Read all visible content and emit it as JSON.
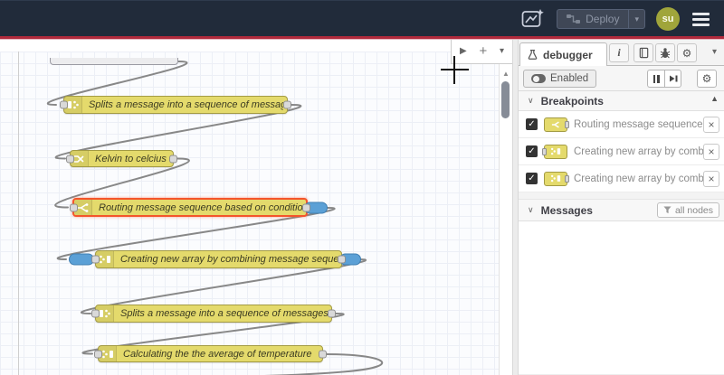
{
  "icons": {
    "chevron_down": "∨",
    "caret_down": "▾",
    "scroll_up_arrow": "▲",
    "scroll_right_arrow": "▶",
    "add": "+",
    "check": "✓",
    "gear": "⚙",
    "info": "i",
    "close": "×"
  },
  "header": {
    "deploy": {
      "label": "Deploy"
    },
    "avatar": {
      "initials": "su"
    }
  },
  "canvas": {
    "nodes": [
      {
        "type": "partial-node",
        "label": ""
      },
      {
        "label": "Splits a message into a sequence of messages.",
        "icon": "split-icon"
      },
      {
        "label": "Kelvin to celcius",
        "icon": "change-icon"
      },
      {
        "label": "Routing message sequence based on condition",
        "icon": "switch-icon",
        "selected": true,
        "breakpoints": [
          "output"
        ]
      },
      {
        "label": "Creating new array by combining message sequence",
        "icon": "join-icon",
        "breakpoints": [
          "input",
          "output"
        ]
      },
      {
        "label": "Splits a message into a sequence of messages.",
        "icon": "split-icon"
      },
      {
        "label": "Calculating the the average of temperature",
        "icon": "join-icon"
      }
    ]
  },
  "sidebar": {
    "tab": {
      "label": "debugger"
    },
    "toolbar": {
      "enabled_label": "Enabled"
    },
    "breakpoints": {
      "title": "Breakpoints",
      "items": [
        {
          "checked": true,
          "icon": "switch-icon",
          "label": "Routing message sequence based on condition"
        },
        {
          "checked": true,
          "icon": "join-icon",
          "label": "Creating new array by combining message sequence"
        },
        {
          "checked": true,
          "icon": "join-icon",
          "label": "Creating new array by combining message sequence"
        }
      ]
    },
    "messages": {
      "title": "Messages",
      "filter_label": "all nodes"
    }
  },
  "colors": {
    "header_bg": "#212b3a",
    "alert_line": "#b02a3c",
    "node_fill": "#e4da6c",
    "node_selected_border": "#f4552b",
    "breakpoint_marker": "#5ba0d6",
    "wire": "#888888",
    "avatar_bg": "#a0a53b"
  }
}
